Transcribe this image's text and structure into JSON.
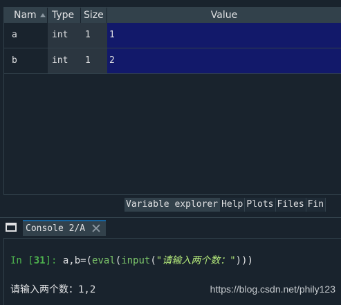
{
  "variable_explorer": {
    "columns": {
      "name": "Nam",
      "type": "Type",
      "size": "Size",
      "value": "Value"
    },
    "rows": [
      {
        "name": "a",
        "type": "int",
        "size": "1",
        "value": "1"
      },
      {
        "name": "b",
        "type": "int",
        "size": "1",
        "value": "2"
      }
    ]
  },
  "pane_tabs": [
    "Variable explorer",
    "Help",
    "Plots",
    "Files",
    "Fin"
  ],
  "console": {
    "tab_label": "Console 2/A",
    "input_prompt_in": "In [",
    "input_prompt_num": "31",
    "input_prompt_close": "]: ",
    "code_part1": "a,b=(",
    "code_eval": "eval",
    "code_paren": "(",
    "code_input": "input",
    "code_paren2": "(",
    "code_string": "\"请输入两个数：\"",
    "code_close": ")))",
    "output_line": "请输入两个数：1,2"
  },
  "watermark": "https://blog.csdn.net/phily123",
  "colors": {
    "background": "#19232d",
    "header": "#32414b",
    "value_cell": "#12196a",
    "prompt": "#4eb34e"
  }
}
